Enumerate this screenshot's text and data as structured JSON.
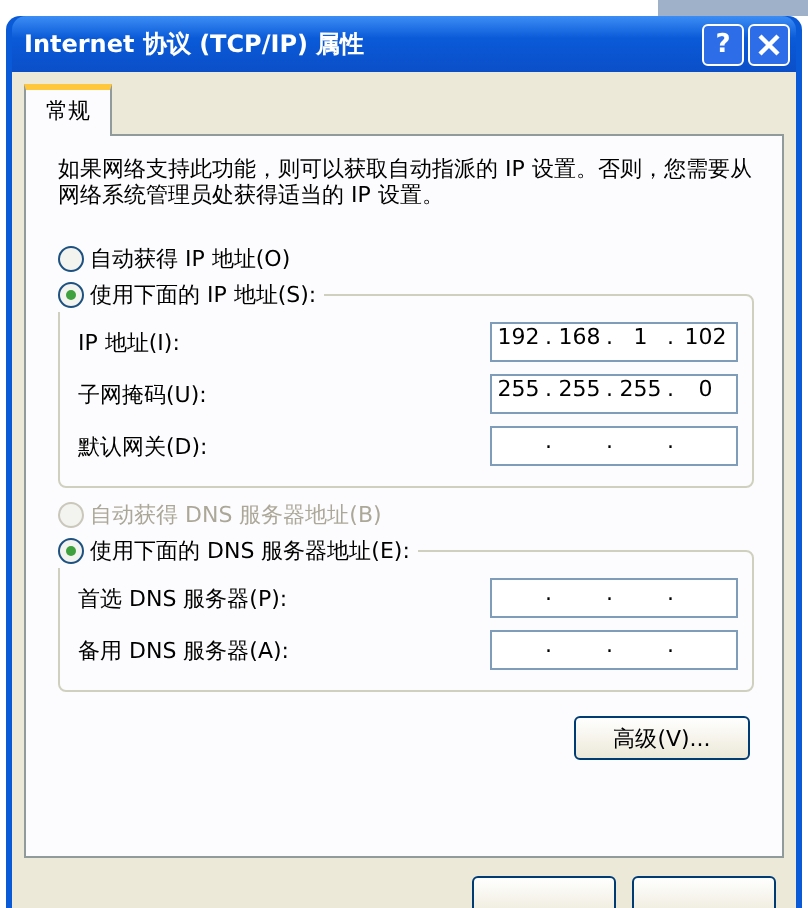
{
  "window": {
    "title": "Internet 协议 (TCP/IP) 属性",
    "buttons": [
      {
        "kind": "help",
        "label": "?"
      },
      {
        "kind": "close"
      }
    ]
  },
  "tabs": [
    {
      "label": "常规",
      "selected": true
    }
  ],
  "intro": "如果网络支持此功能，则可以获取自动指派的 IP 设置。否则，您需要从网络系统管理员处获得适当的 IP 设置。",
  "ip": {
    "auto": {
      "label": "自动获得 IP 地址(O)",
      "selected": false,
      "disabled": false
    },
    "manual": {
      "label": "使用下面的 IP 地址(S):",
      "selected": true,
      "disabled": false
    },
    "fields": [
      {
        "label": "IP 地址(I):",
        "octets": [
          "192",
          "168",
          "1",
          "102"
        ],
        "dots": [
          ".",
          ".",
          "."
        ]
      },
      {
        "label": "子网掩码(U):",
        "octets": [
          "255",
          "255",
          "255",
          "0"
        ],
        "dots": [
          ".",
          ".",
          "."
        ]
      },
      {
        "label": "默认网关(D):",
        "dots": [
          ".",
          ".",
          "."
        ]
      }
    ]
  },
  "dns": {
    "auto": {
      "label": "自动获得 DNS 服务器地址(B)",
      "selected": false,
      "disabled": true
    },
    "manual": {
      "label": "使用下面的 DNS 服务器地址(E):",
      "selected": true,
      "disabled": false
    },
    "fields": [
      {
        "label": "首选 DNS 服务器(P):",
        "dots": [
          ".",
          ".",
          "."
        ]
      },
      {
        "label": "备用 DNS 服务器(A):",
        "dots": [
          ".",
          ".",
          "."
        ]
      }
    ]
  },
  "advanced_button": "高级(V)..."
}
